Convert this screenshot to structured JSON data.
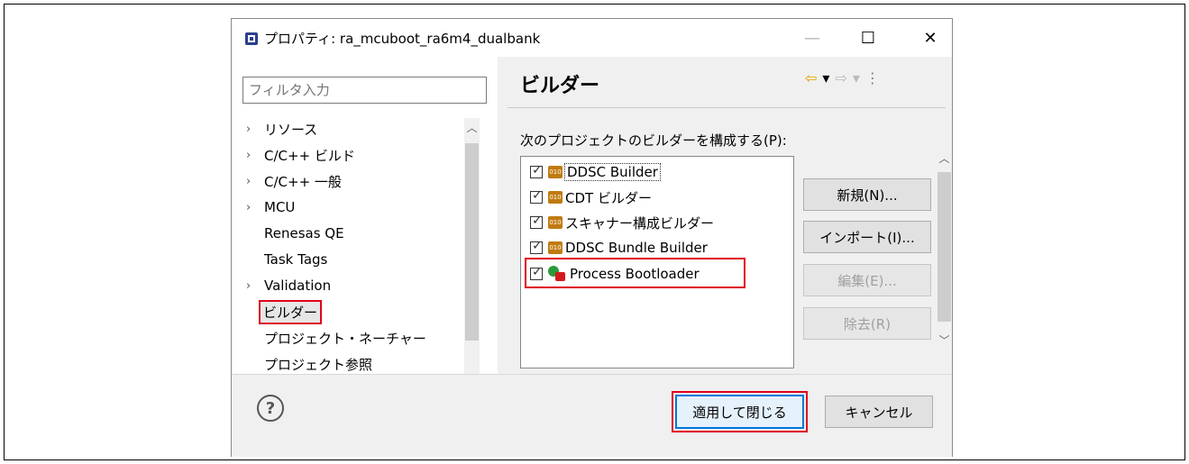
{
  "window": {
    "title": "プロパティ: ra_mcuboot_ra6m4_dualbank",
    "minimize_glyph": "—",
    "maximize_glyph": "☐",
    "close_glyph": "✕"
  },
  "filter": {
    "placeholder": "フィルタ入力"
  },
  "tree": {
    "items": [
      {
        "label": "リソース",
        "expandable": true
      },
      {
        "label": "C/C++ ビルド",
        "expandable": true
      },
      {
        "label": "C/C++ 一般",
        "expandable": true
      },
      {
        "label": "MCU",
        "expandable": true
      },
      {
        "label": "Renesas QE",
        "expandable": false
      },
      {
        "label": "Task Tags",
        "expandable": false
      },
      {
        "label": "Validation",
        "expandable": true
      },
      {
        "label": "ビルダー",
        "expandable": false,
        "selected": true
      },
      {
        "label": "プロジェクト・ネーチャー",
        "expandable": false
      },
      {
        "label": "プロジェクト参照",
        "expandable": false
      }
    ]
  },
  "page": {
    "title": "ビルダー",
    "section_label": "次のプロジェクトのビルダーを構成する(P):",
    "nav": {
      "back": "⇦",
      "dropdown": "▾",
      "forward": "⇨",
      "menu": "⋮"
    }
  },
  "builders": [
    {
      "name": "DDSC Builder",
      "checked": true,
      "icon": "binary-builder-icon"
    },
    {
      "name": "CDT ビルダー",
      "checked": true,
      "icon": "binary-builder-icon"
    },
    {
      "name": "スキャナー構成ビルダー",
      "checked": true,
      "icon": "binary-builder-icon"
    },
    {
      "name": "DDSC Bundle Builder",
      "checked": true,
      "icon": "binary-builder-icon"
    },
    {
      "name": "Process Bootloader",
      "checked": true,
      "icon": "launch-config-icon"
    }
  ],
  "buttons": {
    "new": "新規(N)...",
    "import": "インポート(I)...",
    "edit": "編集(E)...",
    "remove": "除去(R)",
    "apply_close": "適用して閉じる",
    "cancel": "キャンセル"
  },
  "colors": {
    "highlight": "#e0001a",
    "focus": "#0078d7"
  }
}
